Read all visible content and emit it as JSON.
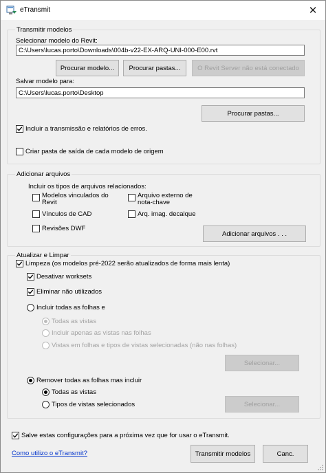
{
  "window": {
    "title": "eTransmit",
    "icon": "etransmit-app-icon",
    "close_glyph": "✕"
  },
  "transmit_group": {
    "title": "Transmitir modelos",
    "select_label": "Selecionar modelo do Revit:",
    "model_path": "C:\\Users\\lucas.porto\\Downloads\\004b-v22-EX-ARQ-UNI-000-E00.rvt",
    "browse_model_button": "Procurar modelo...",
    "browse_folders_button": "Procurar pastas...",
    "revit_server_button": "O Revit Server não está conectado",
    "save_label": "Salvar modelo para:",
    "save_path": "C:\\Users\\lucas.porto\\Desktop",
    "browse_save_folders_button": "Procurar pastas...",
    "include_reports_label": "Incluir a transmissão e relatórios de erros.",
    "include_reports_checked": true,
    "create_folder_label": "Criar pasta de saída de cada modelo de origem",
    "create_folder_checked": false
  },
  "files_group": {
    "title": "Adicionar arquivos",
    "include_label": "Incluir os tipos de arquivos relacionados:",
    "linked_models_label": "Modelos vinculados do Revit",
    "linked_models_checked": false,
    "external_keynote_label": "Arquivo externo de nota-chave",
    "external_keynote_checked": false,
    "cad_links_label": "Vínculos de CAD",
    "cad_links_checked": false,
    "decal_images_label": "Arq. imag. decalque",
    "decal_images_checked": false,
    "dwf_markups_label": "Revisões DWF",
    "dwf_markups_checked": false,
    "add_files_button": "Adicionar arquivos . . ."
  },
  "cleanup_group": {
    "title": "Atualizar e Limpar",
    "cleanup_label": "Limpeza (os modelos pré-2022 serão atualizados de forma mais lenta)",
    "cleanup_checked": true,
    "disable_worksets_label": "Desativar worksets",
    "disable_worksets_checked": true,
    "purge_label": "Eliminar não utilizados",
    "purge_checked": true,
    "include_all_sheets_label": "Incluir todas as folhas e",
    "include_all_sheets_selected": false,
    "all_views_label": "Todas as vistas",
    "views_on_sheets_label": "Incluir apenas as vistas nas folhas",
    "selected_views_label": "Vistas em folhas e tipos de vistas selecionadas (não nas folhas)",
    "select_button_1": "Selecionar...",
    "remove_all_sheets_label": "Remover todas as folhas mas incluir",
    "remove_all_sheets_selected": true,
    "remove_all_views_label": "Todas as vistas",
    "remove_all_views_selected": true,
    "selected_view_types_label": "Tipos de vistas selecionados",
    "selected_view_types_selected": false,
    "select_button_2": "Selecionar..."
  },
  "footer": {
    "save_settings_label": "Salve estas configurações para a próxima vez que for usar o eTransmit.",
    "save_settings_checked": true,
    "help_link": "Como utilizo o eTransmit?",
    "transmit_button": "Transmitir modelos",
    "cancel_button": "Canc."
  }
}
